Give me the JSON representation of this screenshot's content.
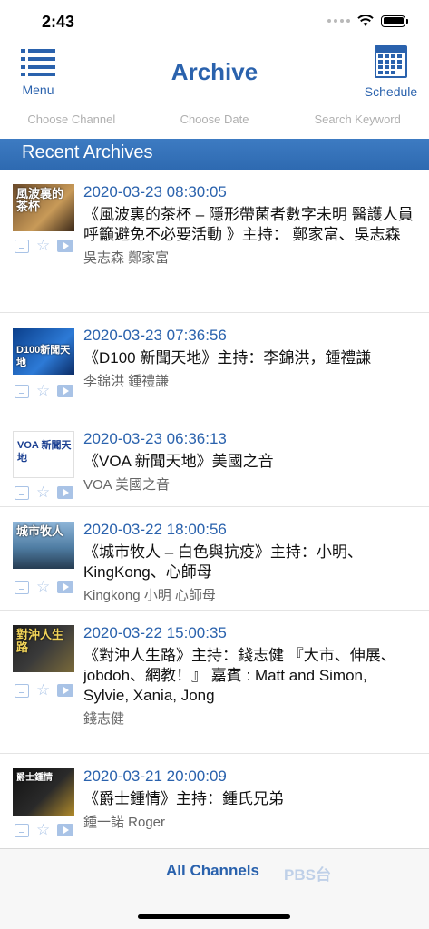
{
  "status": {
    "time": "2:43"
  },
  "nav": {
    "menu_label": "Menu",
    "title": "Archive",
    "schedule_label": "Schedule",
    "accent": "#2a62ad"
  },
  "filters": {
    "channel": "Choose Channel",
    "date": "Choose Date",
    "keyword": "Search Keyword"
  },
  "section": {
    "title": "Recent Archives"
  },
  "archives": [
    {
      "thumb_text": "風波裏的茶杯",
      "date": "2020-03-23 08:30:05",
      "title": "《風波裏的茶杯 – 隱形帶菌者數字未明 醫護人員呼籲避免不必要活動 》主持： 鄭家富、吳志森",
      "hosts": "吳志森 鄭家富"
    },
    {
      "thumb_text": "D100新聞天地",
      "date": "2020-03-23 07:36:56",
      "title": "《D100 新聞天地》主持：李錦洪，鍾禮謙",
      "hosts": "李錦洪 鍾禮謙"
    },
    {
      "thumb_text": "VOA 新聞天地",
      "date": "2020-03-23 06:36:13",
      "title": "《VOA 新聞天地》美國之音",
      "hosts": "VOA 美國之音"
    },
    {
      "thumb_text": "城市牧人",
      "date": "2020-03-22 18:00:56",
      "title": "《城市牧人 – 白色與抗疫》主持：小明、KingKong、心師母",
      "hosts": "Kingkong 小明 心師母"
    },
    {
      "thumb_text": "對沖人生路",
      "date": "2020-03-22 15:00:35",
      "title": "《對沖人生路》主持：錢志健 『大市、伸展、jobdoh、網教！』 嘉賓 : Matt and Simon, Sylvie, Xania, Jong",
      "hosts": "錢志健"
    },
    {
      "thumb_text": "爵士鍾情",
      "date": "2020-03-21 20:00:09",
      "title": "《爵士鍾情》主持：鍾氏兄弟",
      "hosts": "鍾一諾 Roger"
    }
  ],
  "tabs": {
    "all_channels": "All Channels",
    "pbs": "PBS台"
  }
}
